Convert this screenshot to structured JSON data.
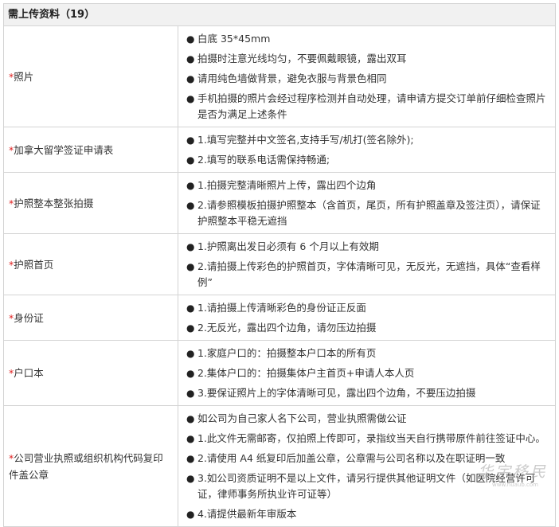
{
  "header": {
    "title": "需上传资料（19）"
  },
  "rows": [
    {
      "label": "照片",
      "items": [
        "白底  35*45mm",
        "拍摄时注意光线均匀，不要佩戴眼镜，露出双耳",
        "请用纯色墙做背景，避免衣服与背景色相同",
        "手机拍摄的照片会经过程序检测并自动处理，请申请方提交订单前仔细检查照片是否为满足上述条件"
      ]
    },
    {
      "label": "加拿大留学签证申请表",
      "items": [
        "1.填写完整并中文签名,支持手写/机打(签名除外);",
        "2.填写的联系电话需保持畅通;"
      ]
    },
    {
      "label": "护照整本整张拍摄",
      "items": [
        "1.拍摄完整清晰照片上传，露出四个边角",
        "2.请参照模板拍摄护照整本（含首页，尾页，所有护照盖章及签注页），请保证护照整本平稳无遮挡"
      ]
    },
    {
      "label": "护照首页",
      "items": [
        "1.护照离出发日必须有 6 个月以上有效期",
        "2.请拍摄上传彩色的护照首页，字体清晰可见，无反光，无遮挡，具体“查看样例”"
      ]
    },
    {
      "label": "身份证",
      "items": [
        "1.请拍摄上传清晰彩色的身份证正反面",
        "2.无反光，露出四个边角，请勿压边拍摄"
      ]
    },
    {
      "label": "户口本",
      "items": [
        "1.家庭户口的：拍摄整本户口本的所有页",
        "2.集体户口的：拍摄集体户主首页+申请人本人页",
        "3.要保证照片上的字体清晰可见，露出四个边角，不要压边拍摄"
      ]
    },
    {
      "label": "公司营业执照或组织机构代码复印件盖公章",
      "items": [
        "如公司为自己家人名下公司，营业执照需做公证",
        "1.此文件无需邮寄，仅拍照上传即可，录指纹当天自行携带原件前往签证中心。",
        "2.请使用 A4 纸复印后加盖公章，公章需与公司名称以及在职证明一致",
        "3.如公司资质证明不是以上文件，请另行提供其他证明文件（如医院经营许可证，律师事务所执业许可证等）",
        "4.请提供最新年审版本"
      ]
    }
  ],
  "required_mark": "*",
  "bullet_char": "●",
  "watermark": {
    "text": "华宇移民",
    "sub": "www.huaub.com"
  },
  "colors": {
    "required": "#e02020",
    "border": "#d4d4d4",
    "header_bg": "#f1f1f1"
  }
}
